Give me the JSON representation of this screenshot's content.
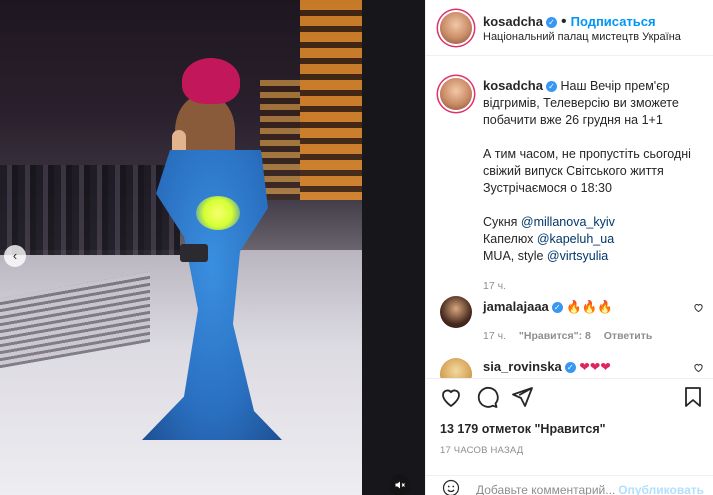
{
  "header": {
    "username": "kosadcha",
    "follow_label": "Подписаться",
    "separator": "•",
    "location": "Національний палац мистецтв Україна"
  },
  "caption": {
    "username": "kosadcha",
    "line1": "Наш Вечір прем'єр відгримів, Телеверсію ви зможете побачити вже 26 грудня на 1+1",
    "line2": "А тим часом, не пропустіть сьогодні свіжий випуск Світського життя",
    "line3": "Зустрічаємося о 18:30",
    "dress_label": "Сукня",
    "dress_mention": "@millanova_kyiv",
    "hat_label": "Капелюх",
    "hat_mention": "@kapeluh_ua",
    "mua_label": "MUA, style",
    "mua_mention": "@virtsyulia",
    "age": "17 ч."
  },
  "comments": [
    {
      "username": "jamalajaaa",
      "text": "🔥🔥🔥",
      "age": "17 ч.",
      "likes": "\"Нравится\": 8",
      "reply_label": "Ответить"
    },
    {
      "username": "sia_rovinska",
      "text": "❤❤❤"
    }
  ],
  "actions": {
    "likes_text": "13 179 отметок \"Нравится\"",
    "timestamp": "17 ЧАСОВ НАЗАД"
  },
  "add_comment": {
    "placeholder": "Добавьте комментарий...",
    "post_label": "Опубликовать"
  },
  "colors": {
    "accent": "#0095f6",
    "verified": "#3897f0",
    "story_ring": "#e1306c"
  }
}
